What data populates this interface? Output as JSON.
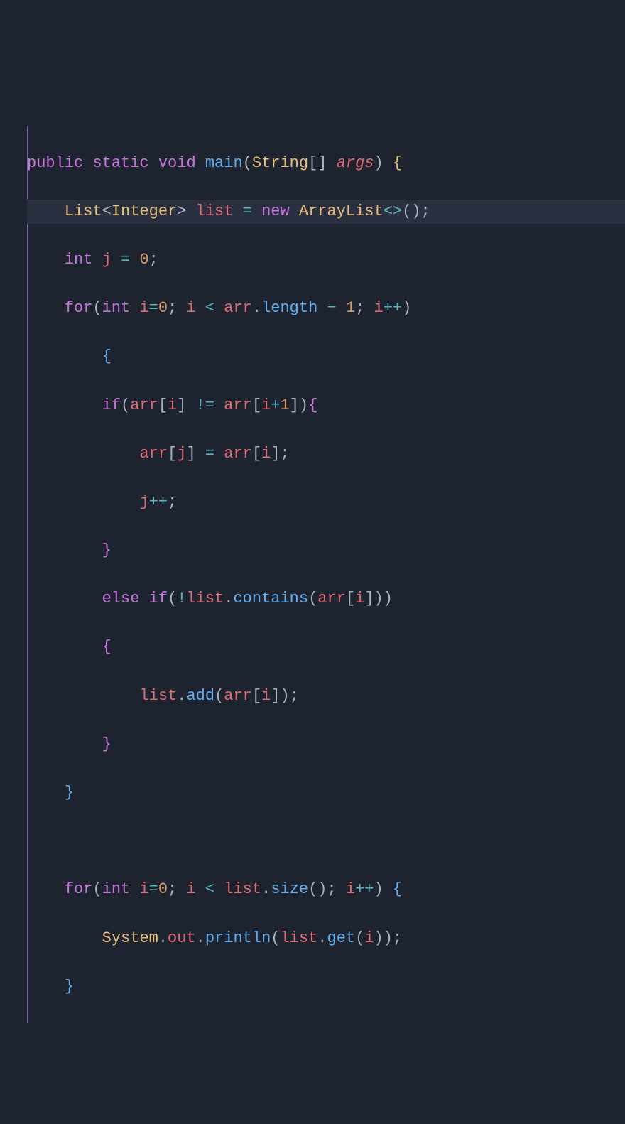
{
  "code": {
    "language": "java",
    "tokens": {
      "kw_public": "public",
      "kw_static": "static",
      "kw_void": "void",
      "fn_main": "main",
      "type_String": "String",
      "param_args": "args",
      "type_List": "List",
      "type_Integer": "Integer",
      "var_list": "list",
      "op_assign": "=",
      "kw_new": "new",
      "type_ArrayList": "ArrayList",
      "kw_int": "int",
      "var_j": "j",
      "num_0": "0",
      "kw_for": "for",
      "var_i": "i",
      "op_lt": "<",
      "var_arr": "arr",
      "prop_length": "length",
      "op_minus": "−",
      "num_1": "1",
      "op_inc": "++",
      "kw_if": "if",
      "op_neq": "!=",
      "op_plus": "+",
      "kw_else": "else",
      "op_not": "!",
      "fn_contains": "contains",
      "fn_add": "add",
      "fn_size": "size",
      "type_System": "System",
      "var_out": "out",
      "fn_println": "println",
      "fn_get": "get"
    },
    "punct": {
      "lparen": "(",
      "rparen": ")",
      "lbrack": "[",
      "rbrack": "]",
      "lbrace": "{",
      "rbrace": "}",
      "semi": ";",
      "dot": ".",
      "lt": "<",
      "gt": ">",
      "diam": "<>",
      "comma": ","
    }
  }
}
